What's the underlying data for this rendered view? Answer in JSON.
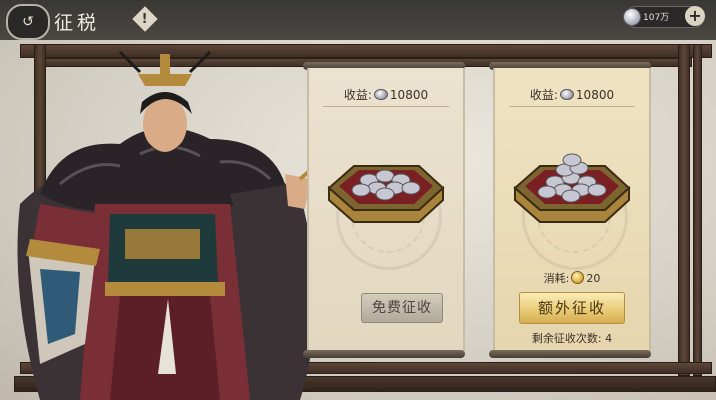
{
  "header": {
    "back_icon": "back-swirl-icon",
    "title": "征税",
    "help_icon": "exclamation-diamond-icon",
    "currency": {
      "icon": "silver-coin-icon",
      "value": "107万",
      "add_icon": "plus-icon"
    }
  },
  "scrolls": [
    {
      "income_label": "收益:",
      "income_value": "10800",
      "icon": "silver-coin-icon",
      "tray_icon": "silver-tray-icon",
      "button_label": "免费征收"
    },
    {
      "income_label": "收益:",
      "income_value": "10800",
      "icon": "silver-coin-icon",
      "tray_icon": "silver-tray-icon",
      "cost_label": "消耗:",
      "cost_icon": "gold-coin-icon",
      "cost_value": "20",
      "button_label": "额外征收",
      "remaining_label": "剩余征收次数:",
      "remaining_value": "4"
    }
  ],
  "colors": {
    "topbar": "#3a3835",
    "wood": "#5c4638",
    "paper": "#ebe3d0",
    "gold_button": "#e7c973",
    "grey_button": "#c2bcad"
  }
}
